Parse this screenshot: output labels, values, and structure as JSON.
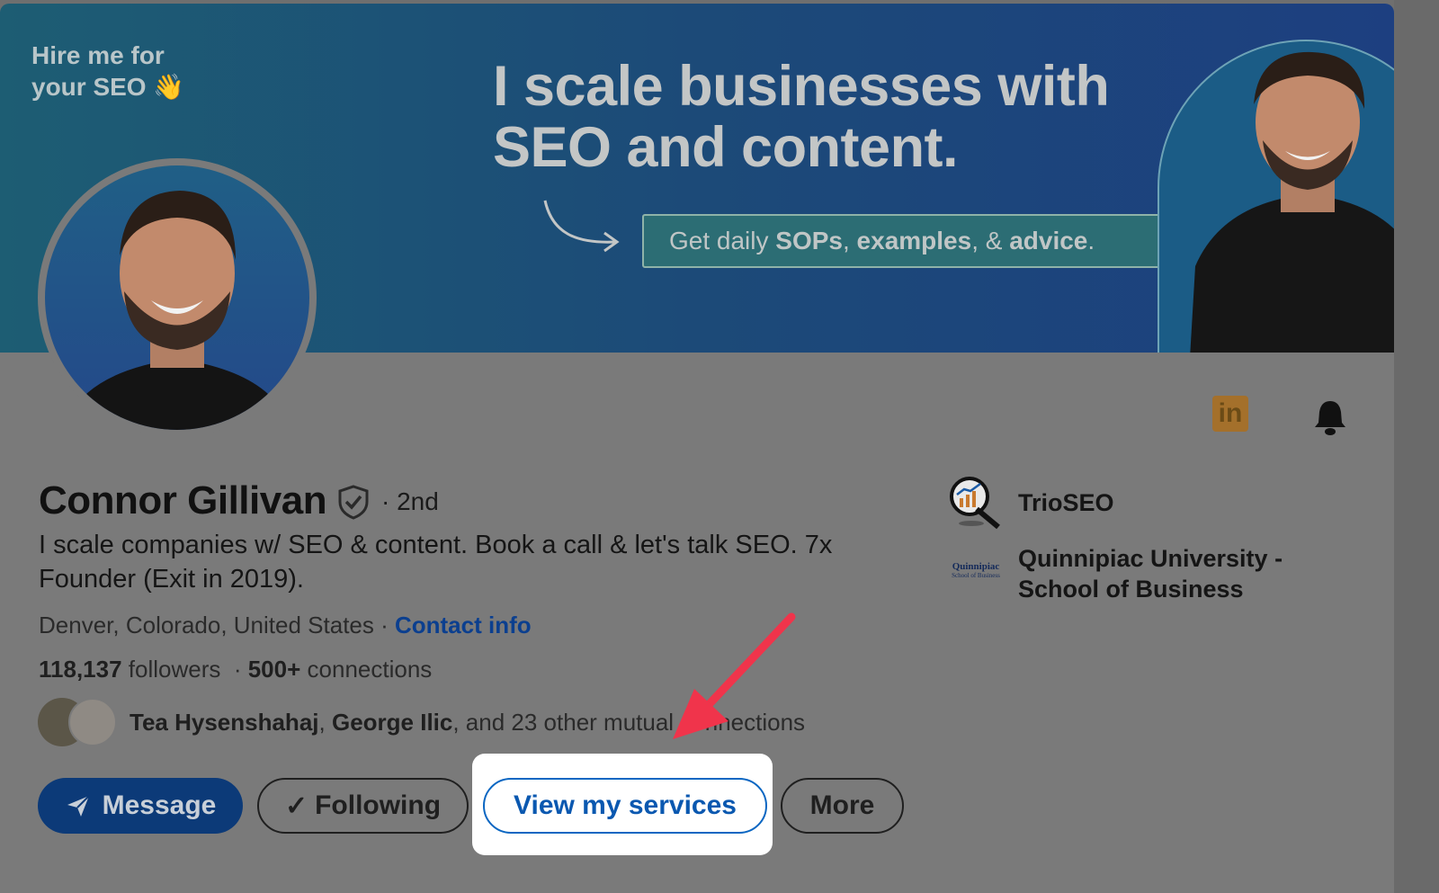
{
  "banner": {
    "hire_line1": "Hire me for",
    "hire_line2": "your SEO 👋",
    "headline_line1": "I scale businesses with",
    "headline_line2": "SEO and content.",
    "cta_prefix": "Get daily ",
    "cta_b1": "SOPs",
    "cta_sep1": ", ",
    "cta_b2": "examples",
    "cta_sep2": ", & ",
    "cta_b3": "advice",
    "cta_suffix": "."
  },
  "profile": {
    "name": "Connor Gillivan",
    "degree": "· 2nd",
    "headline": "I scale companies w/ SEO & content. Book a call & let's talk SEO. 7x Founder (Exit in 2019).",
    "location": "Denver, Colorado, United States · ",
    "contact_label": "Contact info",
    "followers_count": "118,137",
    "followers_label": " followers  · ",
    "connections_count": "500+",
    "connections_label": " connections",
    "mutual_name1": "Tea Hysenshahaj",
    "mutual_sep": ", ",
    "mutual_name2": "George Ilic",
    "mutual_suffix": ", and 23 other mutual connections"
  },
  "actions": {
    "message_label": "Message",
    "following_label": "Following",
    "services_label": "View my services",
    "more_label": "More"
  },
  "experience": {
    "company": "TrioSEO",
    "school_line1": "Quinnipiac University -",
    "school_line2": "School of Business",
    "school_logo_line1": "Quinnipiac",
    "school_logo_line2": "School of Business"
  },
  "icons": {
    "linkedin_glyph": "in",
    "accent_blue": "#0a66c2",
    "arrow_red": "#f0344b"
  }
}
